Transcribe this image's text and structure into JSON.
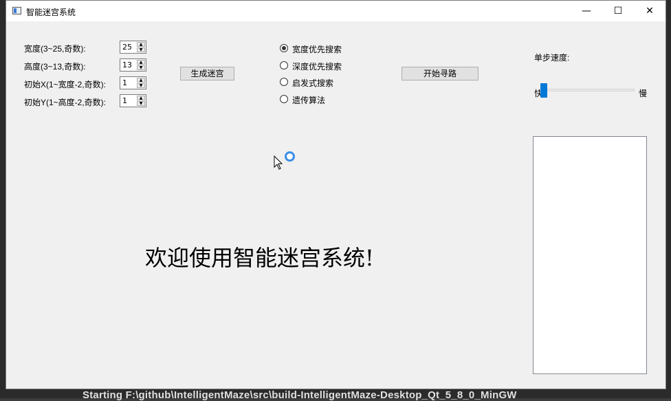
{
  "title_bar": {
    "title": "智能迷宫系统",
    "minimize_glyph": "—",
    "maximize_glyph": "☐",
    "close_glyph": "✕"
  },
  "params": {
    "width_label": "宽度(3~25,奇数):",
    "width_value": "25",
    "height_label": "高度(3~13,奇数):",
    "height_value": "13",
    "start_x_label": "初始X(1~宽度-2,奇数):",
    "start_x_value": "1",
    "start_y_label": "初始Y(1~高度-2,奇数):",
    "start_y_value": "1"
  },
  "buttons": {
    "generate": "生成迷宫",
    "start": "开始寻路"
  },
  "algorithms": [
    {
      "label": "宽度优先搜索",
      "checked": true
    },
    {
      "label": "深度优先搜索",
      "checked": false
    },
    {
      "label": "启发式搜索",
      "checked": false
    },
    {
      "label": "遗传算法",
      "checked": false
    }
  ],
  "speed": {
    "label": "单步速度:",
    "fast": "快",
    "slow": "慢",
    "level": 0
  },
  "welcome": "欢迎使用智能迷宫系统!",
  "background": {
    "terminal_text": "Starting F:\\github\\IntelligentMaze\\src\\build-IntelligentMaze-Desktop_Qt_5_8_0_MinGW"
  },
  "colors": {
    "accent": "#0078d7",
    "window_bg": "#f0f0f0"
  }
}
